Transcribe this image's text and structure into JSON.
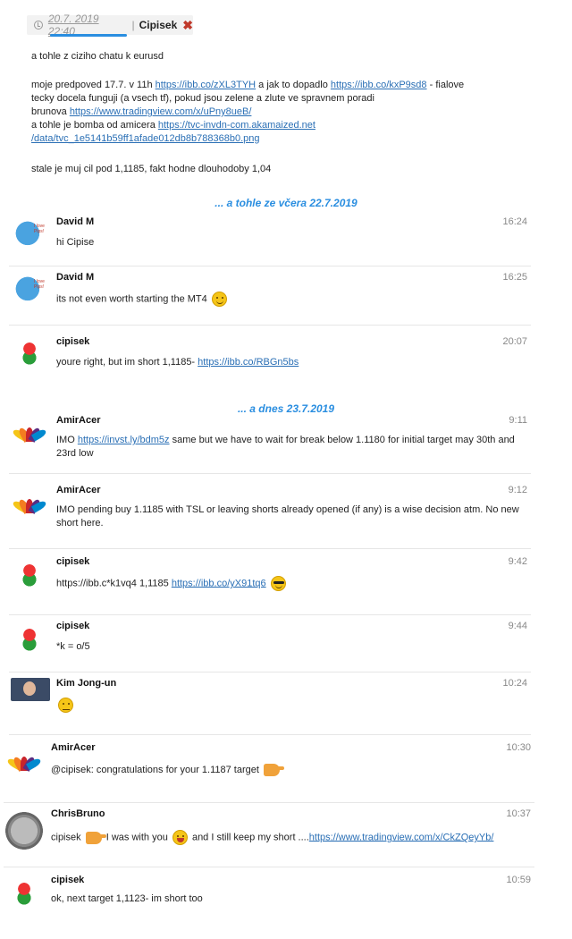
{
  "post": {
    "date": "20.7. 2019 22:40",
    "separator": "|",
    "author": "Cipisek",
    "close_icon": "✖"
  },
  "body": {
    "line1": "a tohle z ciziho chatu k eurusd",
    "p1_a": "moje predpoved 17.7. v 11h ",
    "p1_link1": "https://ibb.co/zXL3TYH",
    "p1_b": " a jak to dopadlo ",
    "p1_link2": "https://ibb.co/kxP9sd8",
    "p1_c": " - fialove",
    "p2": "tecky docela funguji (a vsech tf), pokud jsou zelene a zlute ve spravnem poradi",
    "p3_a": "brunova ",
    "p3_link": "https://www.tradingview.com/x/uPny8ueB/",
    "p4_a": "a tohle je bomba od amicera ",
    "p4_link": "https://tvc-invdn-com.akamaized.net",
    "p5_link": "/data/tvc_1e5141b59ff1afade012db8b788368b0.png",
    "p6": "stale je muj cil pod 1,1185, fakt hodne dlouhodoby 1,04"
  },
  "dividers": {
    "yesterday": "... a tohle ze včera 22.7.2019",
    "today": "... a dnes 23.7.2019"
  },
  "avatar_bird_label": "I love Pips!",
  "messages": [
    {
      "name": "David M",
      "time": "16:24",
      "text": "hi Cipise"
    },
    {
      "name": "David M",
      "time": "16:25",
      "text": "its not even worth starting the MT4"
    },
    {
      "name": "cipisek",
      "time": "20:07",
      "text": "youre right, but im short 1,1185- ",
      "link": "https://ibb.co/RBGn5bs"
    },
    {
      "name": "AmirAcer",
      "time": "9:11",
      "text_a": "IMO ",
      "link": "https://invst.ly/bdm5z",
      "text_b": " same but we have to wait for break below 1.1180 for initial target may 30th and 23rd low"
    },
    {
      "name": "AmirAcer",
      "time": "9:12",
      "text": "IMO pending buy 1.1185 with TSL or leaving shorts already opened (if any) is a wise decision atm. No new short here."
    },
    {
      "name": "cipisek",
      "time": "9:42",
      "text": "https://ibb.c*k1vq4 1,1185 ",
      "link": "https://ibb.co/yX91tq6"
    },
    {
      "name": "cipisek",
      "time": "9:44",
      "text": "*k = o/5"
    },
    {
      "name": "Kim Jong-un",
      "time": "10:24",
      "text": ""
    },
    {
      "name": "AmirAcer",
      "time": "10:30",
      "text": "@cipisek: congratulations for your 1.1187 target "
    },
    {
      "name": "ChrisBruno",
      "time": "10:37",
      "text_a": "cipisek ",
      "text_b": " I was with you ",
      "text_c": " and I still keep my short ....",
      "link": "https://www.tradingview.com/x/CkZQeyYb/"
    },
    {
      "name": "cipisek",
      "time": "10:59",
      "text": "ok, next target 1,1123- im short too"
    }
  ]
}
